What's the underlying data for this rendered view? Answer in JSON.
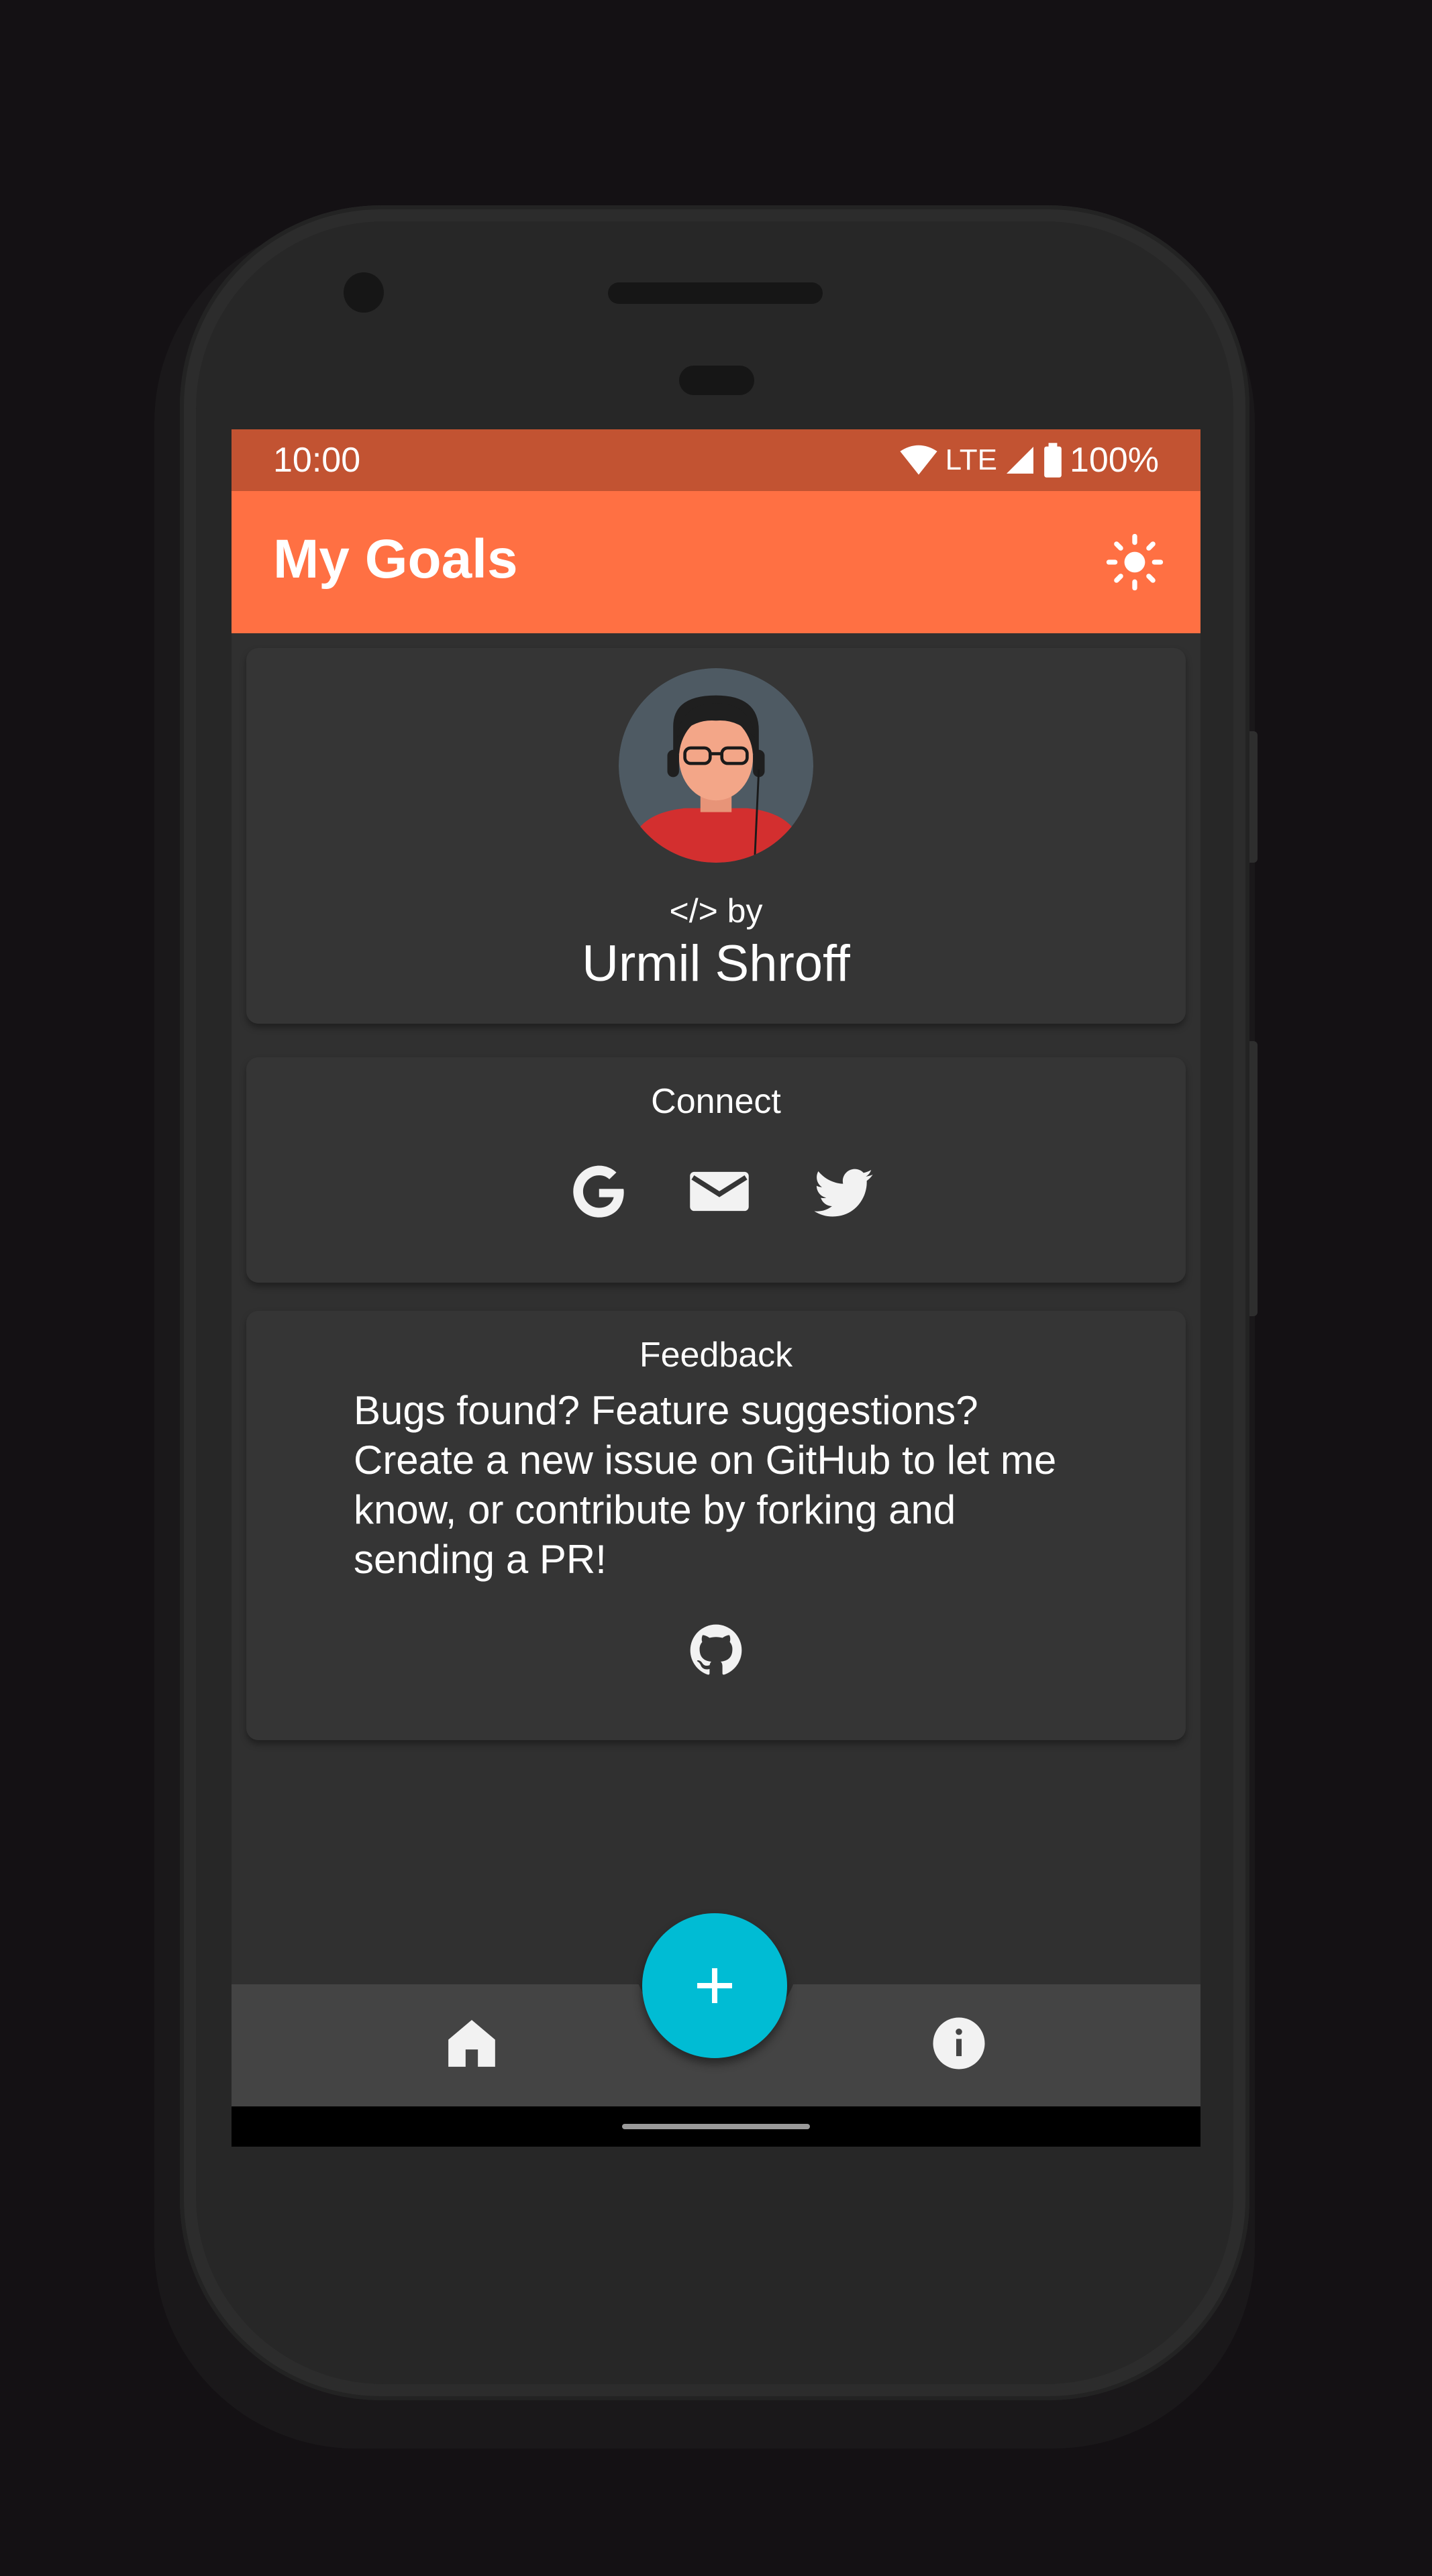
{
  "status_bar": {
    "time": "10:00",
    "network": "LTE",
    "battery": "100%",
    "color": "#c25332"
  },
  "app_bar": {
    "title": "My Goals",
    "color": "#ff7043",
    "theme_icon": "sun-icon"
  },
  "about": {
    "by_text": "</> by",
    "author": "Urmil Shroff",
    "avatar_icon": "avatar"
  },
  "connect": {
    "title": "Connect",
    "icons": [
      "google-icon",
      "email-icon",
      "twitter-icon"
    ]
  },
  "feedback": {
    "title": "Feedback",
    "body": "Bugs found? Feature suggestions? Create a new issue on GitHub to let me know, or contribute by forking and sending a PR!",
    "icon": "github-icon"
  },
  "bottom_nav": {
    "left_icon": "home-icon",
    "right_icon": "info-icon",
    "fab_icon": "plus-icon",
    "fab_color": "#00bcd4"
  }
}
